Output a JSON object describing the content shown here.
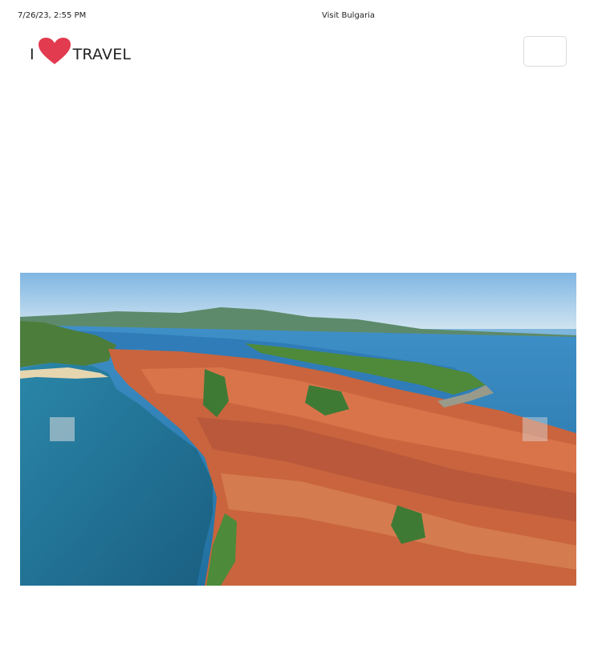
{
  "print_header": {
    "date": "7/26/23, 2:55 PM",
    "title": "Visit Bulgaria"
  },
  "logo": {
    "prefix": "I",
    "icon": "heart-icon",
    "suffix": "TRAVEL",
    "heart_color": "#e23a4e"
  },
  "menu_button": {
    "icon": "hamburger-menu-icon"
  },
  "carousel": {
    "image_subject": "aerial-town-peninsula",
    "prev_icon": "chevron-left-icon",
    "next_icon": "chevron-right-icon"
  }
}
